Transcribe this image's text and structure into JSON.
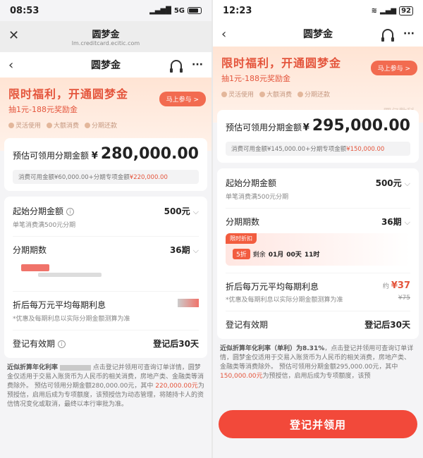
{
  "left": {
    "status": {
      "time": "08:53",
      "net": "5G"
    },
    "wx": {
      "title": "圆梦金",
      "url": "lm.creditcard.ecitic.com"
    },
    "nav": {
      "title": "圆梦金"
    },
    "banner": {
      "headline": "限时福利，开通圆梦金",
      "sub": "抽1元-188元奖励金",
      "tags": [
        "灵活使用",
        "大额消费",
        "分期还款"
      ],
      "go": "马上参与 >"
    },
    "amount": {
      "label": "预估可领用分期金额",
      "currency": "¥",
      "value": "280,000.00",
      "detail_prefix": "消费可用金额¥60,000.00+分期专项金额",
      "detail_red": "¥220,000.00"
    },
    "start": {
      "label": "起始分期金额",
      "value": "500元",
      "sub": "单笔消费满500元分期"
    },
    "period": {
      "label": "分期期数",
      "value": "36期"
    },
    "rate": {
      "label": "折后每万元平均每期利息",
      "sub": "*优惠及每期利息以实际分期金额测算为准"
    },
    "valid": {
      "label": "登记有效期",
      "value": "登记后30天"
    },
    "foot": {
      "p1": "近似折算年化利率",
      "p2": "点击登记并领用可查询订单详情，圆梦金仅适用于交易入账货币为人民币的相关消费，房地产类、金融类等消费除外。 预估可领用分期金额280,000.00元，其中",
      "red": "220,000.00元",
      "p3": "为预授信，启用后成为专项额度，该预授信为动态管理，将随持卡人的资信情况变化或取消，最终以本行审批为准。"
    }
  },
  "right": {
    "status": {
      "time": "12:23",
      "battery": "92"
    },
    "nav": {
      "title": "圆梦金"
    },
    "banner": {
      "headline": "限时福利，开通圆梦金",
      "sub": "抽1元-188元奖励金",
      "tags": [
        "灵活使用",
        "大额消费",
        "分期还款"
      ],
      "go": "马上参与 >",
      "watermark": "圆亿数科"
    },
    "amount": {
      "label": "预估可领用分期金额",
      "currency": "¥",
      "value": "295,000.00",
      "detail_prefix": "消费可用金额¥145,000.00+分期专项金额",
      "detail_red": "¥150,000.00"
    },
    "start": {
      "label": "起始分期金额",
      "value": "500元",
      "sub": "单笔消费满500元分期"
    },
    "period": {
      "label": "分期期数",
      "value": "36期"
    },
    "discount": {
      "label": "限时折扣",
      "badge": "5折",
      "prefix": "剩余",
      "d1": "01月",
      "d2": "00天",
      "d3": "11时"
    },
    "rate": {
      "label": "折后每万元平均每期利息",
      "pre": "约",
      "value": "¥37",
      "sub": "*优惠及每期利息以实际分期金额测算为准",
      "old": "¥75"
    },
    "valid": {
      "label": "登记有效期",
      "value": "登记后30天"
    },
    "foot": {
      "p1": "近似折算年化利率（单利）为8.31%",
      "p2": "，点击登记并领用可查询订单详情，圆梦金仅适用于交易入账货币为人民币的相关消费，房地产类、金融类等消费除外。 预估可领用分期金额295,000.00元，其中",
      "red": "150,000.00元",
      "p3": "为预授信，启用后成为专项额度，该预"
    },
    "cta": "登记并领用"
  },
  "colors": {
    "accent": "#f2493a",
    "red": "#e4553c",
    "banner": "#ffe4d4"
  }
}
